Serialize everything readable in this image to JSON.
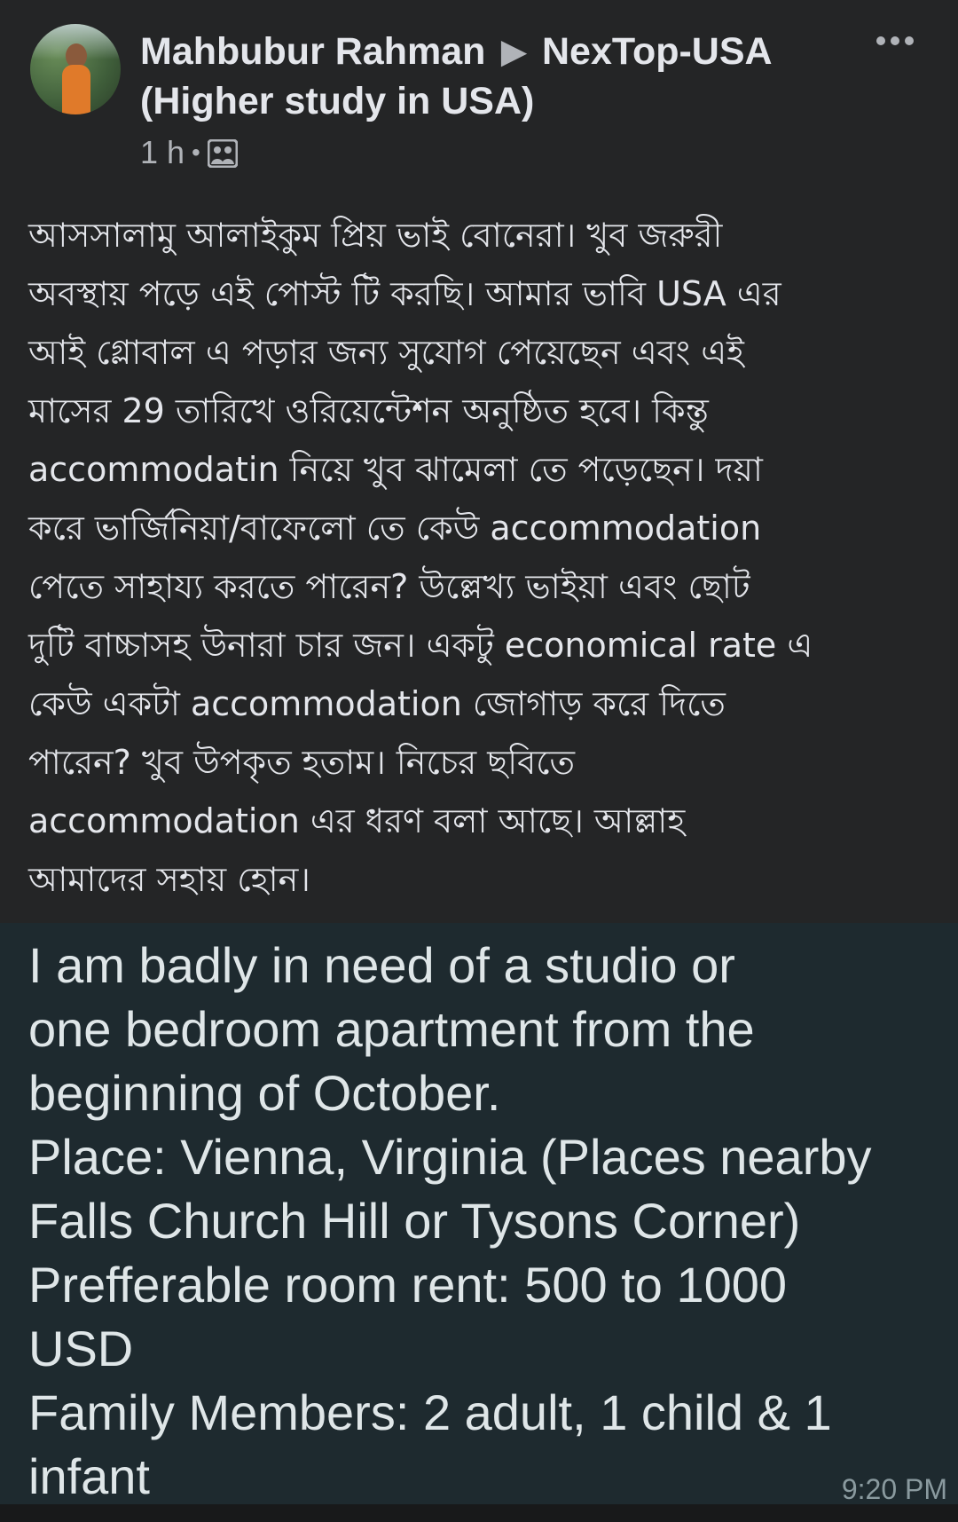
{
  "post": {
    "author": "Mahbubur Rahman",
    "group": "NexTop-USA",
    "group_suffix": "(Higher study in USA)",
    "time": "1 h",
    "separator": "•",
    "audience_icon": "group-members-icon",
    "more_icon": "more-options-icon",
    "body_lines": [
      "আসসালামু আলাইকুম প্রিয় ভাই বোনেরা। খুব জরুরী",
      "অবস্থায় পড়ে এই পোস্ট টি করছি। আমার ভাবি USA এর",
      "আই গ্লোবাল এ পড়ার জন্য সুযোগ পেয়েছেন এবং এই",
      "মাসের 29 তারিখে ওরিয়েন্টেশন অনুষ্ঠিত হবে। কিন্তু",
      "accommodatin নিয়ে খুব ঝামেলা তে পড়েছেন। দয়া",
      "করে ভার্জিনিয়া/বাফেলো তে কেউ accommodation",
      "পেতে সাহায্য করতে পারেন? উল্লেখ্য ভাইয়া এবং ছোট",
      "দুটি বাচ্চাসহ উনারা চার জন। একটু economical rate এ",
      "কেউ একটা accommodation জোগাড় করে দিতে",
      "পারেন? খুব উপকৃত হতাম। নিচের ছবিতে",
      "accommodation এর ধরণ বলা আছে। আল্লাহ",
      "আমাদের সহায় হোন।"
    ]
  },
  "attachment": {
    "lines": [
      "I am badly in need of a studio or",
      "one bedroom apartment from the",
      "beginning of October.",
      "Place: Vienna, Virginia (Places nearby",
      "Falls Church Hill or Tysons Corner)",
      "Prefferable room rent: 500 to 1000",
      "USD",
      "Family Members: 2 adult, 1 child & 1",
      "infant"
    ],
    "timestamp": "9:20 PM"
  }
}
